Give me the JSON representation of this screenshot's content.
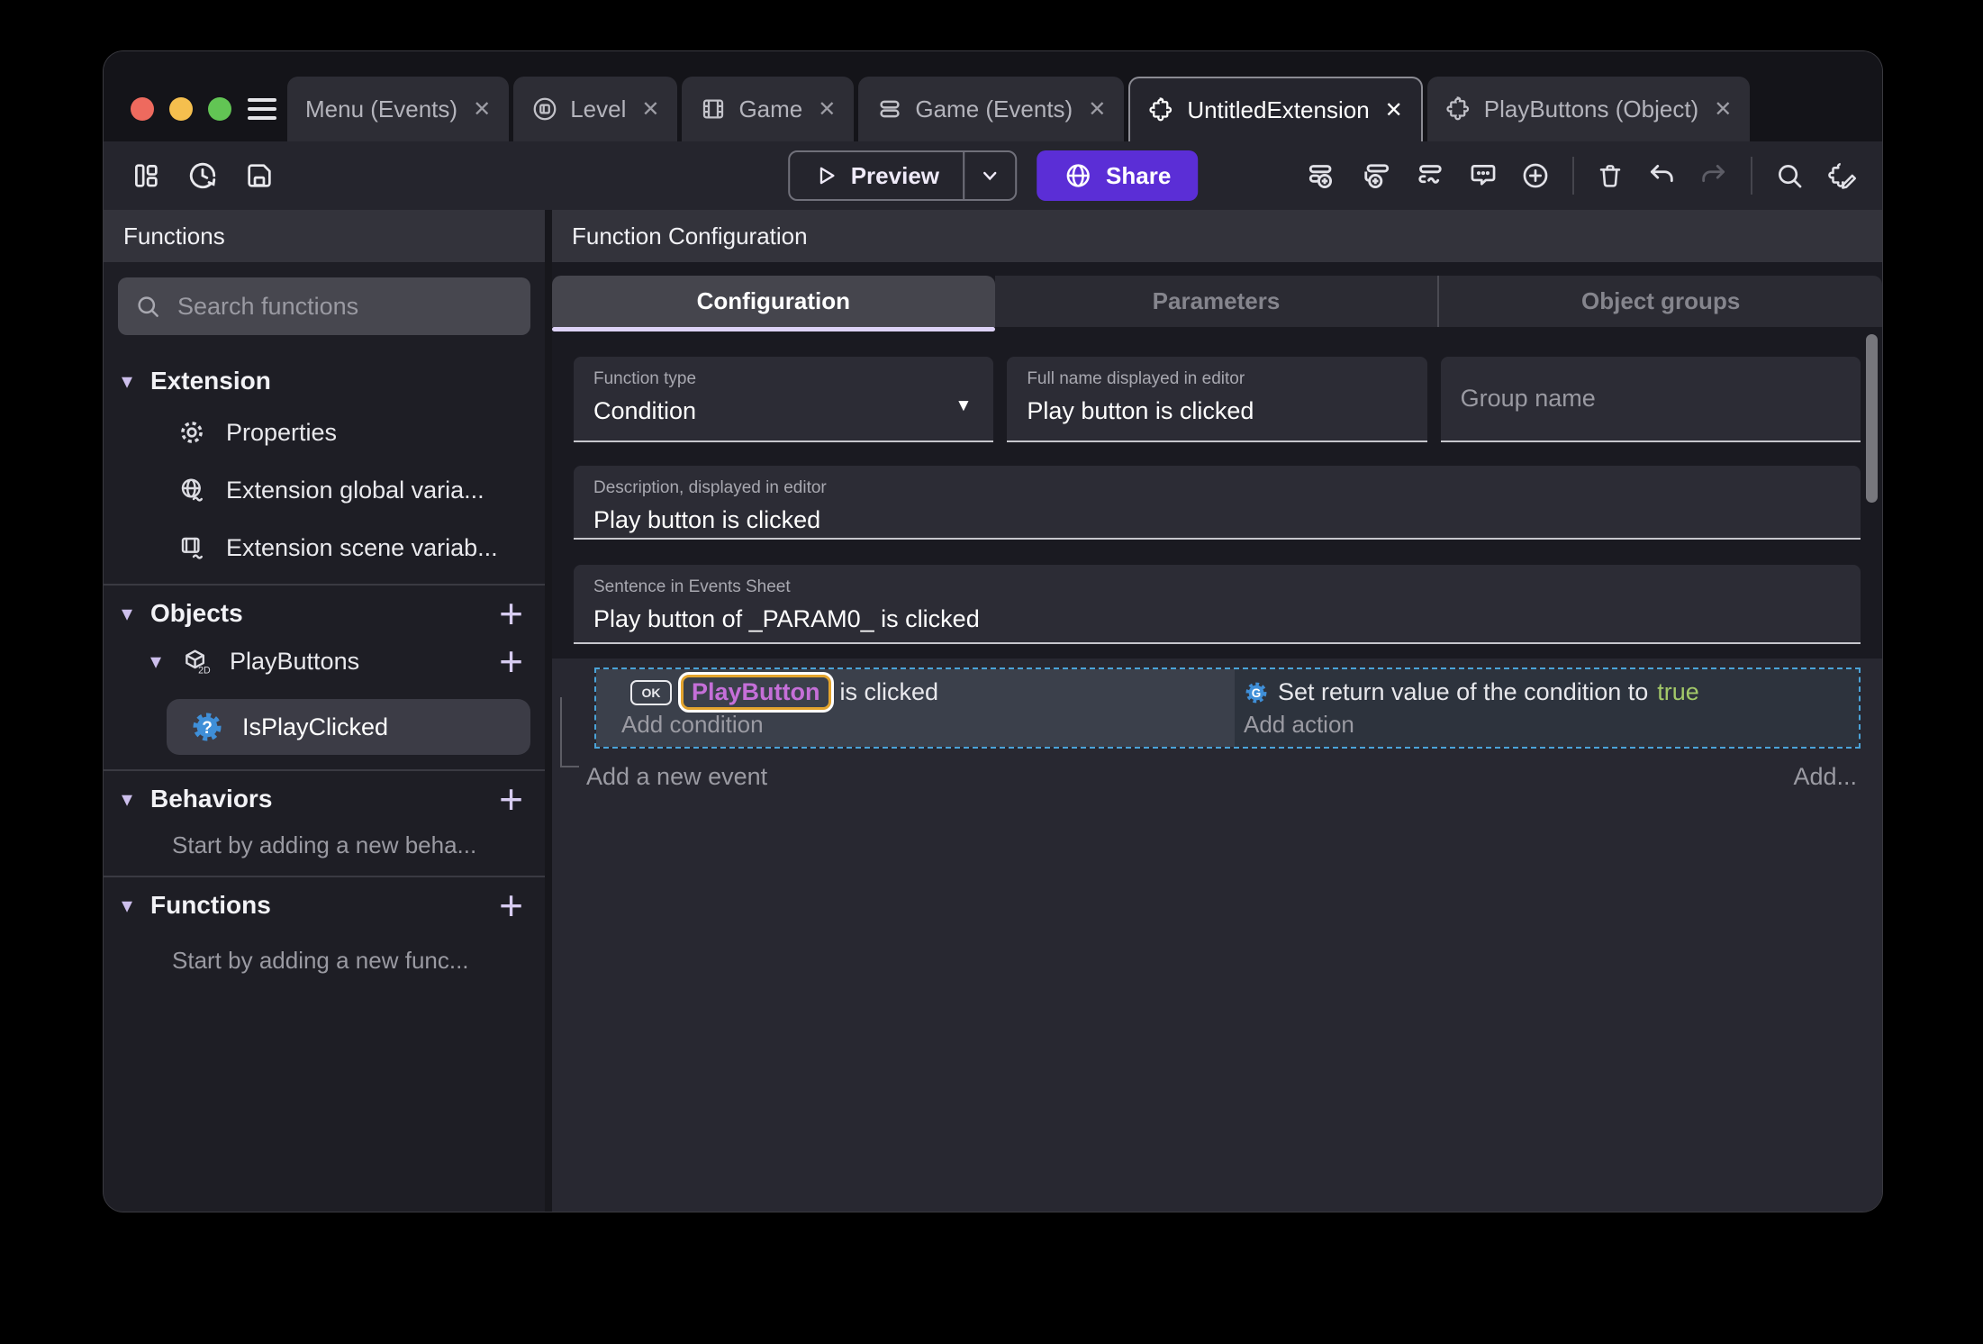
{
  "icons": {
    "close": "✕",
    "chevron_down": "▾",
    "plus": "+",
    "dropdown": "▼"
  },
  "colors": {
    "accent_purple": "#5b2ed6",
    "object_purple": "#c56fd8",
    "highlight_orange": "#e3a42e",
    "selection_blue": "#4aa3d8",
    "true_green": "#a3c969",
    "mac_red": "#ee6a5e",
    "mac_yellow": "#f5bf4e",
    "mac_green": "#62c554"
  },
  "titlebar": {
    "tabs": [
      {
        "label": "Menu (Events)",
        "icon": "none"
      },
      {
        "label": "Level",
        "icon": "level-icon"
      },
      {
        "label": "Game",
        "icon": "scene-icon"
      },
      {
        "label": "Game (Events)",
        "icon": "events-icon"
      },
      {
        "label": "UntitledExtension",
        "icon": "extension-icon",
        "active": true
      },
      {
        "label": "PlayButtons (Object)",
        "icon": "extension-icon"
      }
    ]
  },
  "toolbar": {
    "preview_label": "Preview",
    "share_label": "Share"
  },
  "sidebar": {
    "title": "Functions",
    "search_placeholder": "Search functions",
    "extension_section": "Extension",
    "items": [
      {
        "label": "Properties"
      },
      {
        "label": "Extension global varia..."
      },
      {
        "label": "Extension scene variab..."
      }
    ],
    "objects_section": "Objects",
    "object_name": "PlayButtons",
    "selected_function": "IsPlayClicked",
    "behaviors_section": "Behaviors",
    "behaviors_hint": "Start by adding a new beha...",
    "functions_section": "Functions",
    "functions_hint": "Start by adding a new func..."
  },
  "main": {
    "title": "Function Configuration",
    "tabs": [
      {
        "label": "Configuration",
        "active": true
      },
      {
        "label": "Parameters"
      },
      {
        "label": "Object groups"
      }
    ],
    "fields": {
      "function_type": {
        "label": "Function type",
        "value": "Condition"
      },
      "full_name": {
        "label": "Full name displayed in editor",
        "value": "Play button is clicked"
      },
      "group_name": {
        "placeholder": "Group name"
      },
      "description": {
        "label": "Description, displayed in editor",
        "value": "Play button is clicked"
      },
      "sentence": {
        "label": "Sentence in Events Sheet",
        "value": "Play button of _PARAM0_ is clicked"
      }
    },
    "events": {
      "ok_badge": "OK",
      "condition_object": "PlayButton",
      "condition_rest": "is clicked",
      "add_condition": "Add condition",
      "action_prefix": "Set return value of the condition to",
      "action_value": "true",
      "add_action": "Add action",
      "add_new_event": "Add a new event",
      "add_more": "Add..."
    }
  }
}
